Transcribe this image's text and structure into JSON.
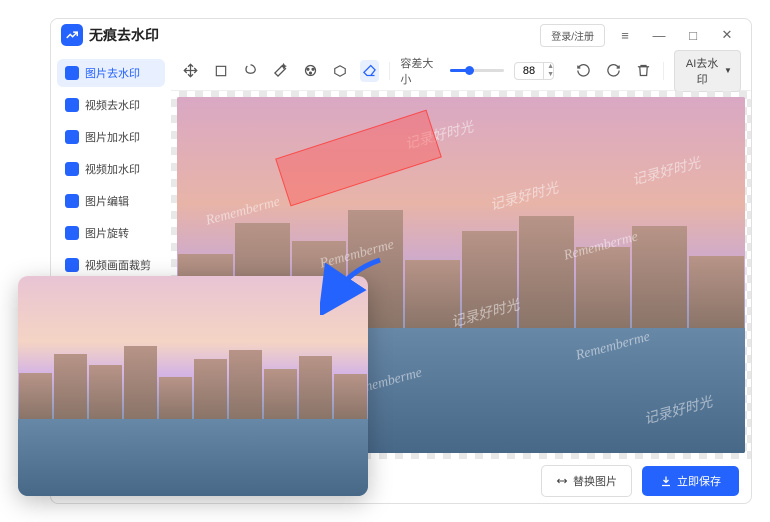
{
  "app": {
    "title": "无痕去水印"
  },
  "titlebar": {
    "login": "登录/注册"
  },
  "sidebar": {
    "items": [
      {
        "label": "图片去水印",
        "active": true
      },
      {
        "label": "视频去水印"
      },
      {
        "label": "图片加水印"
      },
      {
        "label": "视频加水印"
      },
      {
        "label": "图片编辑"
      },
      {
        "label": "图片旋转"
      },
      {
        "label": "视频画面裁剪"
      }
    ]
  },
  "toolbar": {
    "tolerance_label": "容差大小",
    "tolerance_value": "88",
    "ai_label": "AI去水印"
  },
  "watermark": {
    "text1": "记录好时光",
    "text2": "Rememberme"
  },
  "footer": {
    "replace": "替换图片",
    "save": "立即保存"
  }
}
